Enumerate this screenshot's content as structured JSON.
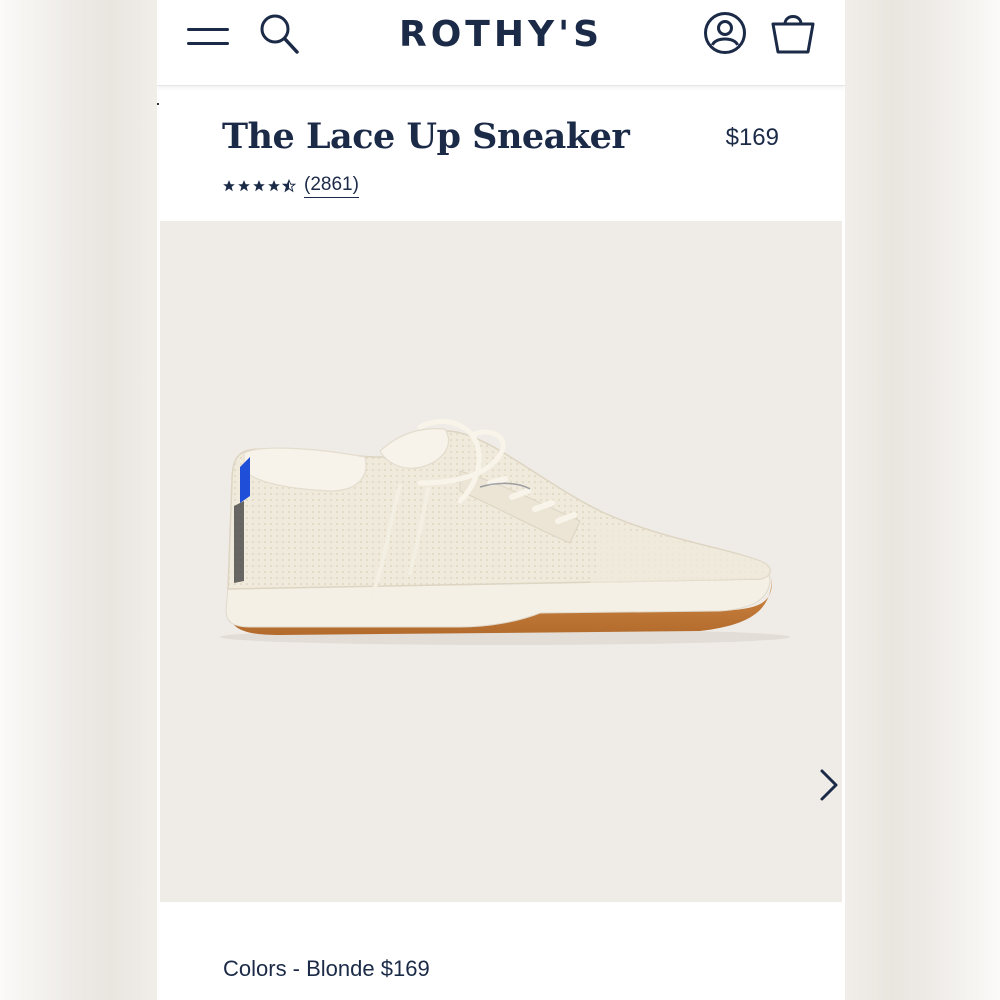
{
  "header": {
    "logo_text": "ROTHY'S",
    "icons": [
      "menu-icon",
      "search-icon",
      "account-icon",
      "shopping-bag-icon"
    ]
  },
  "product": {
    "title": "The Lace Up Sneaker",
    "price": "$169",
    "rating_stars": 4.5,
    "rating_max": 5,
    "review_count_label": "(2861)",
    "image_alt_icon": "sneaker-image",
    "carousel_next_icon": "chevron-right-icon"
  },
  "colors": {
    "line": "Colors - Blonde $169"
  },
  "theme": {
    "navy": "#1b2a47",
    "image_bg": "#efece8",
    "accent_blue": "#1f4fd8",
    "gum_sole": "#c47e3e"
  }
}
